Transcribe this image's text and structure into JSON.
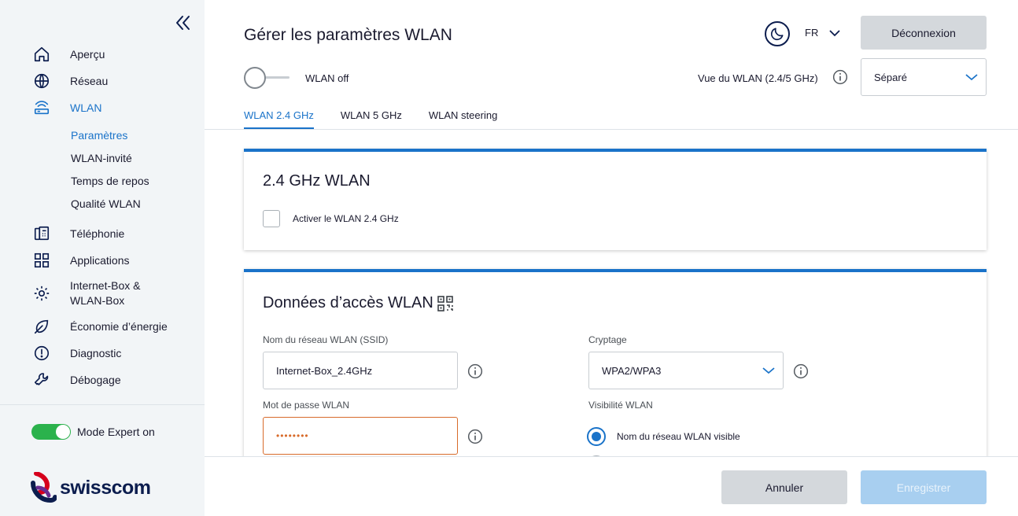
{
  "sidebar": {
    "items": [
      {
        "label": "Aperçu",
        "icon": "home-icon"
      },
      {
        "label": "Réseau",
        "icon": "globe-icon"
      },
      {
        "label": "WLAN",
        "icon": "router-icon"
      },
      {
        "label": "Téléphonie",
        "icon": "phone-icon"
      },
      {
        "label": "Applications",
        "icon": "apps-grid-icon"
      },
      {
        "label": "Internet-Box & WLAN-Box",
        "icon": "gear-icon"
      },
      {
        "label": "Économie d’énergie",
        "icon": "leaf-icon"
      },
      {
        "label": "Diagnostic",
        "icon": "alert-circle-icon"
      },
      {
        "label": "Débogage",
        "icon": "wrench-icon"
      }
    ],
    "wlan_subitems": [
      "Paramètres",
      "WLAN-invité",
      "Temps de repos",
      "Qualité WLAN"
    ],
    "expert_mode_label": "Mode Expert on",
    "logo_text": "swisscom"
  },
  "header": {
    "title": "Gérer les paramètres WLAN",
    "language": "FR",
    "logout_label": "Déconnexion",
    "wlan_toggle_label": "WLAN off",
    "view_label": "Vue du WLAN (2.4/5 GHz)",
    "view_value": "Séparé"
  },
  "tabs": [
    "WLAN 2.4 GHz",
    "WLAN 5 GHz",
    "WLAN steering"
  ],
  "card_24": {
    "title": "2.4 GHz WLAN",
    "checkbox_label": "Activer le WLAN 2.4 GHz"
  },
  "card_access": {
    "title": "Données d’accès WLAN",
    "ssid_label": "Nom du réseau WLAN (SSID)",
    "ssid_value": "Internet-Box_2.4GHz",
    "password_label": "Mot de passe WLAN",
    "password_value": "••••••••",
    "encryption_label": "Cryptage",
    "encryption_value": "WPA2/WPA3",
    "visibility_label": "Visibilité WLAN",
    "visibility_option_1": "Nom du réseau WLAN visible"
  },
  "footer": {
    "cancel_label": "Annuler",
    "save_label": "Enregistrer"
  },
  "colors": {
    "accent": "#1a73c9",
    "toggle_on": "#2bb24c",
    "password_border": "#d86b2b",
    "brand_navy": "#0c1d4e"
  }
}
